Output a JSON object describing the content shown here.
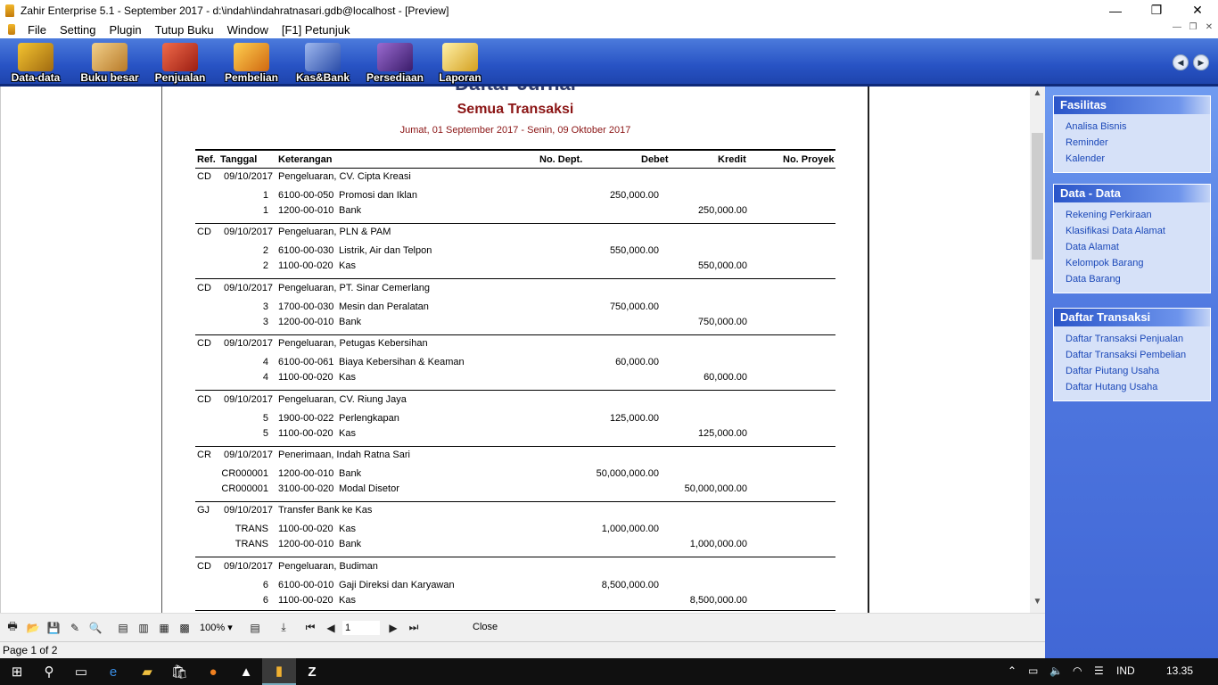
{
  "window": {
    "title": "Zahir Enterprise 5.1 - September 2017 - d:\\indah\\indahratnasari.gdb@localhost - [Preview]"
  },
  "menu": [
    "File",
    "Setting",
    "Plugin",
    "Tutup Buku",
    "Window",
    "[F1] Petunjuk"
  ],
  "toolbar": [
    {
      "label": "Data-data",
      "color": "#f4c430"
    },
    {
      "label": "Buku besar",
      "color": "#e8b04a"
    },
    {
      "label": "Penjualan",
      "color": "#d03a2a"
    },
    {
      "label": "Pembelian",
      "color": "#f0a020"
    },
    {
      "label": "Kas&Bank",
      "color": "#4a74d8"
    },
    {
      "label": "Persediaan",
      "color": "#5d3b8f"
    },
    {
      "label": "Laporan",
      "color": "#f5d35a"
    }
  ],
  "report": {
    "title": "Daftar Jurnal",
    "subtitle": "Semua Transaksi",
    "period": "Jumat, 01 September 2017 - Senin, 09 Oktober 2017",
    "columns": {
      "ref": "Ref.",
      "tanggal": "Tanggal",
      "keterangan": "Keterangan",
      "dept": "No. Dept.",
      "debet": "Debet",
      "kredit": "Kredit",
      "proyek": "No. Proyek"
    },
    "entries": [
      {
        "ref": "CD",
        "date": "09/10/2017",
        "desc": "Pengeluaran, CV. Cipta Kreasi",
        "lines": [
          {
            "no": "1",
            "acct": "6100-00-050",
            "name": "Promosi dan Iklan",
            "debet": "250,000.00",
            "kredit": ""
          },
          {
            "no": "1",
            "acct": "1200-00-010",
            "name": "Bank",
            "debet": "",
            "kredit": "250,000.00"
          }
        ]
      },
      {
        "ref": "CD",
        "date": "09/10/2017",
        "desc": "Pengeluaran, PLN & PAM",
        "lines": [
          {
            "no": "2",
            "acct": "6100-00-030",
            "name": "Listrik, Air dan Telpon",
            "debet": "550,000.00",
            "kredit": ""
          },
          {
            "no": "2",
            "acct": "1100-00-020",
            "name": "Kas",
            "debet": "",
            "kredit": "550,000.00"
          }
        ]
      },
      {
        "ref": "CD",
        "date": "09/10/2017",
        "desc": "Pengeluaran, PT. Sinar Cemerlang",
        "lines": [
          {
            "no": "3",
            "acct": "1700-00-030",
            "name": "Mesin dan Peralatan",
            "debet": "750,000.00",
            "kredit": ""
          },
          {
            "no": "3",
            "acct": "1200-00-010",
            "name": "Bank",
            "debet": "",
            "kredit": "750,000.00"
          }
        ]
      },
      {
        "ref": "CD",
        "date": "09/10/2017",
        "desc": "Pengeluaran, Petugas Kebersihan",
        "lines": [
          {
            "no": "4",
            "acct": "6100-00-061",
            "name": "Biaya Kebersihan & Keaman",
            "debet": "60,000.00",
            "kredit": ""
          },
          {
            "no": "4",
            "acct": "1100-00-020",
            "name": "Kas",
            "debet": "",
            "kredit": "60,000.00"
          }
        ]
      },
      {
        "ref": "CD",
        "date": "09/10/2017",
        "desc": "Pengeluaran, CV. Riung Jaya",
        "lines": [
          {
            "no": "5",
            "acct": "1900-00-022",
            "name": "Perlengkapan",
            "debet": "125,000.00",
            "kredit": ""
          },
          {
            "no": "5",
            "acct": "1100-00-020",
            "name": "Kas",
            "debet": "",
            "kredit": "125,000.00"
          }
        ]
      },
      {
        "ref": "CR",
        "date": "09/10/2017",
        "desc": "Penerimaan, Indah Ratna Sari",
        "lines": [
          {
            "no": "CR000001",
            "acct": "1200-00-010",
            "name": "Bank",
            "debet": "50,000,000.00",
            "kredit": ""
          },
          {
            "no": "CR000001",
            "acct": "3100-00-020",
            "name": "Modal Disetor",
            "debet": "",
            "kredit": "50,000,000.00"
          }
        ]
      },
      {
        "ref": "GJ",
        "date": "09/10/2017",
        "desc": "Transfer Bank ke Kas",
        "lines": [
          {
            "no": "TRANS",
            "acct": "1100-00-020",
            "name": "Kas",
            "debet": "1,000,000.00",
            "kredit": ""
          },
          {
            "no": "TRANS",
            "acct": "1200-00-010",
            "name": "Bank",
            "debet": "",
            "kredit": "1,000,000.00"
          }
        ]
      },
      {
        "ref": "CD",
        "date": "09/10/2017",
        "desc": "Pengeluaran, Budiman",
        "lines": [
          {
            "no": "6",
            "acct": "6100-00-010",
            "name": "Gaji Direksi dan Karyawan",
            "debet": "8,500,000.00",
            "kredit": ""
          },
          {
            "no": "6",
            "acct": "1100-00-020",
            "name": "Kas",
            "debet": "",
            "kredit": "8,500,000.00"
          }
        ]
      }
    ]
  },
  "sidepanel": [
    {
      "title": "Fasilitas",
      "links": [
        "Analisa Bisnis",
        "Reminder",
        "Kalender"
      ]
    },
    {
      "title": "Data - Data",
      "links": [
        "Rekening Perkiraan",
        "Klasifikasi Data Alamat",
        "Data Alamat",
        "Kelompok Barang",
        "Data Barang"
      ]
    },
    {
      "title": "Daftar Transaksi",
      "links": [
        "Daftar Transaksi Penjualan",
        "Daftar Transaksi Pembelian",
        "Daftar Piutang Usaha",
        "Daftar Hutang Usaha"
      ]
    }
  ],
  "preview": {
    "zoom": "100%",
    "page_input": "1",
    "close_label": "Close",
    "status": "Page 1 of 2"
  },
  "taskbar": {
    "lang": "IND",
    "time": "13.35"
  }
}
